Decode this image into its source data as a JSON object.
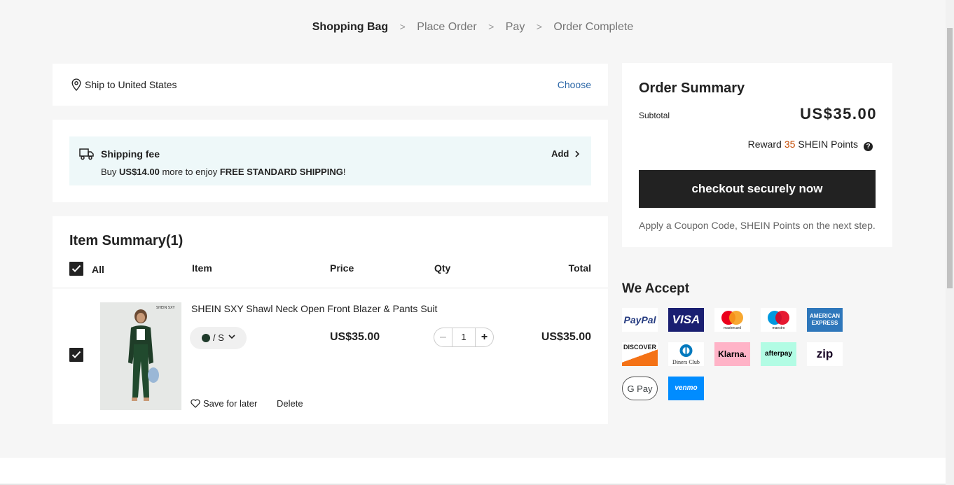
{
  "steps": [
    "Shopping Bag",
    ">",
    "Place Order",
    ">",
    "Pay",
    ">",
    "Order Complete"
  ],
  "ship": {
    "label": "Ship to United States",
    "choose": "Choose"
  },
  "shipping_fee": {
    "title": "Shipping fee",
    "msg_prefix": "Buy ",
    "msg_amount": "US$14.00",
    "msg_middle": " more to enjoy ",
    "msg_bold": "FREE STANDARD SHIPPING",
    "msg_suffix": "!",
    "add": "Add"
  },
  "items": {
    "heading": "Item Summary(1)",
    "all": "All",
    "columns": {
      "item": "Item",
      "price": "Price",
      "qty": "Qty",
      "total": "Total"
    },
    "product": {
      "name": "SHEIN SXY Shawl Neck Open Front Blazer & Pants Suit",
      "variant": "/ S",
      "variant_color": "#1e3a2a",
      "price": "US$35.00",
      "qty": "1",
      "minus": "–",
      "plus": "+",
      "total": "US$35.00",
      "thumb_brand": "SHEIN SXY",
      "save": "Save for later",
      "delete": "Delete"
    }
  },
  "summary": {
    "title": "Order Summary",
    "subtotal_label": "Subtotal",
    "subtotal_value": "US$35.00",
    "reward_prefix": "Reward",
    "reward_points": "35",
    "reward_suffix": "SHEIN Points",
    "help": "?",
    "checkout": "checkout securely now",
    "coupon": "Apply a Coupon Code, SHEIN Points on the next step."
  },
  "accept": {
    "title": "We Accept",
    "methods": [
      "PayPal",
      "VISA",
      "mastercard",
      "maestro",
      "AMERICAN EXPRESS",
      "DISCOVER",
      "Diners Club",
      "Klarna.",
      "afterpay",
      "zip",
      "G Pay",
      "venmo"
    ]
  }
}
